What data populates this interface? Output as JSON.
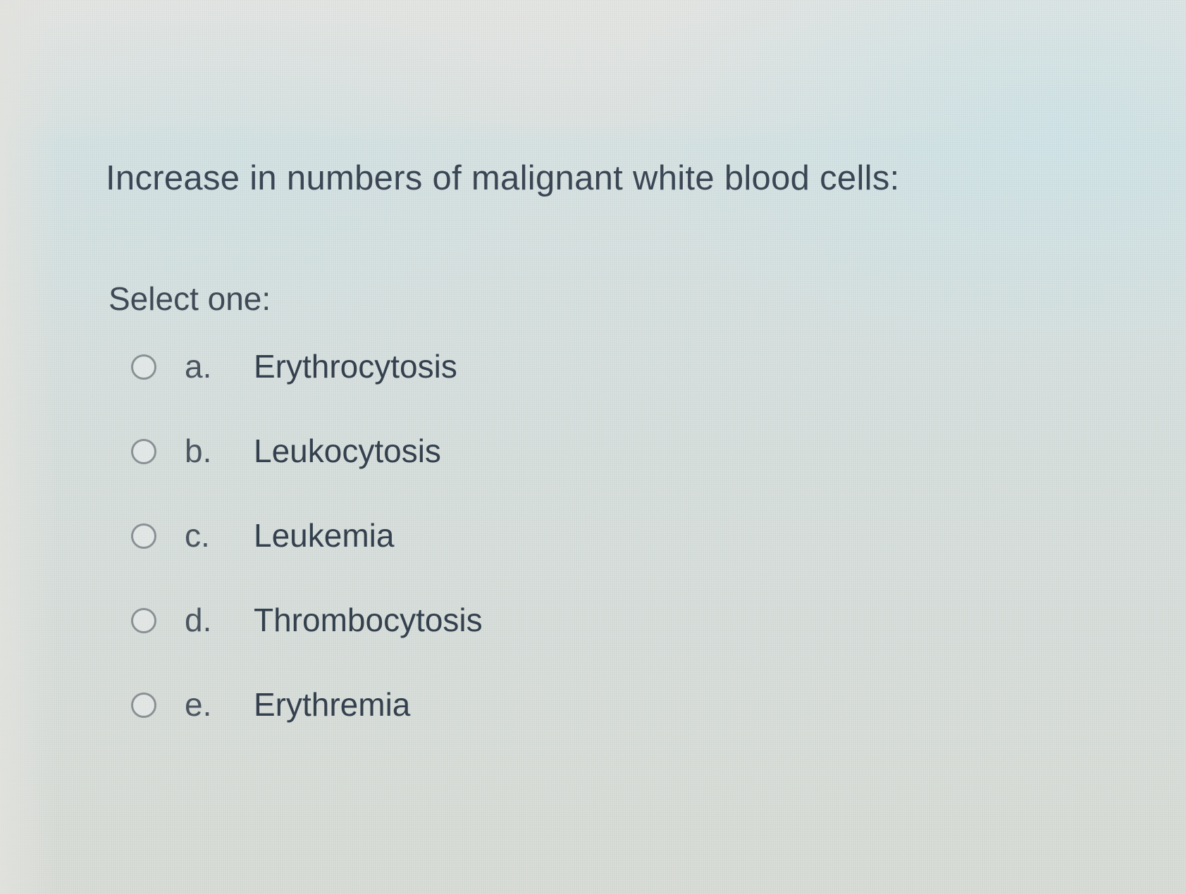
{
  "question": {
    "text": "Increase in numbers of malignant white blood cells:",
    "prompt": "Select one:"
  },
  "options": [
    {
      "letter": "a.",
      "label": "Erythrocytosis",
      "selected": false
    },
    {
      "letter": "b.",
      "label": "Leukocytosis",
      "selected": false
    },
    {
      "letter": "c.",
      "label": "Leukemia",
      "selected": false
    },
    {
      "letter": "d.",
      "label": "Thrombocytosis",
      "selected": false
    },
    {
      "letter": "e.",
      "label": "Erythremia",
      "selected": false
    }
  ],
  "colors": {
    "text": "#3a4654",
    "radio_border": "#8a9194",
    "background": "#d6e2e2"
  }
}
